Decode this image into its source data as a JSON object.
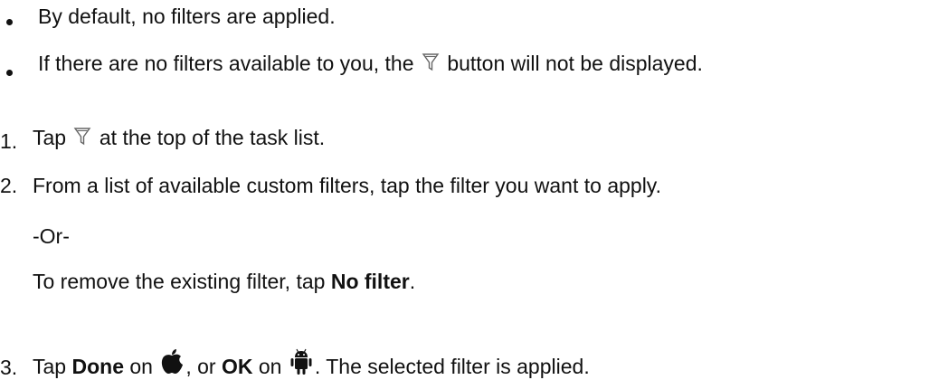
{
  "bullets": [
    {
      "text": "By default, no filters are applied."
    },
    {
      "before": "If there are no filters available to you, the",
      "after": "button will not be displayed."
    }
  ],
  "steps": [
    {
      "number": "1.",
      "before": "Tap",
      "after": "at the top of the task list."
    },
    {
      "number": "2.",
      "text": "From a list of available custom filters, tap the filter you want to apply."
    },
    {
      "number": "3.",
      "pre_done": "Tap",
      "done": "Done",
      "mid1": "on",
      "mid2": ", or",
      "ok": "OK",
      "mid3": "on",
      "after": ". The selected filter is applied."
    }
  ],
  "or_text": "-Or-",
  "remove": {
    "before": "To remove the existing filter, tap",
    "bold": "No filter",
    "after": "."
  },
  "icons": {
    "filter": "filter-funnel-icon",
    "apple": "apple-logo-icon",
    "android": "android-logo-icon"
  }
}
